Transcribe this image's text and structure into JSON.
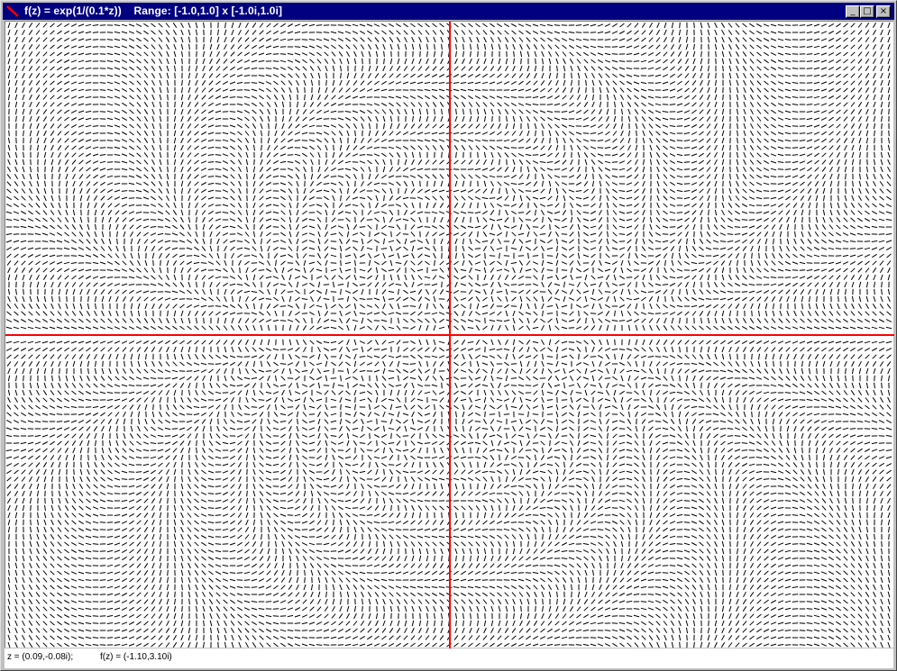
{
  "window": {
    "title": "f(z) = exp(1/(0.1*z))    Range: [-1.0,1.0] x [-1.0i,1.0i]",
    "controls": {
      "minimize_glyph": "_",
      "maximize_glyph": "□",
      "close_glyph": "×"
    },
    "icon": "red-pen-icon"
  },
  "plot": {
    "function_scale": 0.1,
    "x_range": [
      -1.0,
      1.0
    ],
    "y_range": [
      -1.0,
      1.0
    ],
    "axis_color": "#ff0000",
    "line_color": "#000000"
  },
  "status": {
    "z_readout": "z = (0.09,-0.08i);",
    "fz_readout": "f(z) = (-1.10,3.10i)"
  }
}
